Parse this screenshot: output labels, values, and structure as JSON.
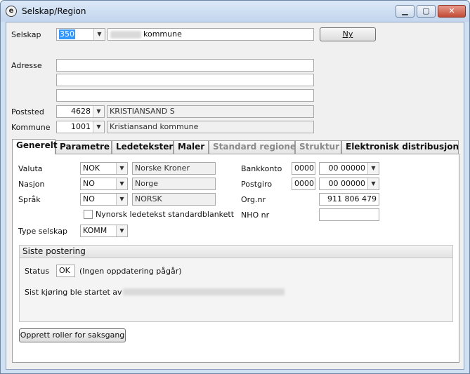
{
  "window": {
    "title": "Selskap/Region",
    "minimize": "▁",
    "maximize": "▢",
    "close": "✕"
  },
  "form": {
    "selskap_label": "Selskap",
    "selskap_value": "350",
    "selskap_name": "kommune",
    "ny_button": "Ny",
    "adresse_label": "Adresse",
    "adresse_lines": [
      "",
      "",
      ""
    ],
    "poststed_label": "Poststed",
    "poststed_code": "4628",
    "poststed_name": "KRISTIANSAND S",
    "kommune_label": "Kommune",
    "kommune_code": "1001",
    "kommune_name": "Kristiansand kommune"
  },
  "tabs": [
    {
      "label": "Generelt",
      "state": "active"
    },
    {
      "label": "Parametre",
      "state": "normal"
    },
    {
      "label": "Ledetekster",
      "state": "normal"
    },
    {
      "label": "Maler",
      "state": "normal"
    },
    {
      "label": "Standard regioner",
      "state": "disabled"
    },
    {
      "label": "Struktur",
      "state": "disabled"
    },
    {
      "label": "Elektronisk distribusjon",
      "state": "normal"
    }
  ],
  "generelt": {
    "valuta_label": "Valuta",
    "valuta_code": "NOK",
    "valuta_name": "Norske Kroner",
    "nasjon_label": "Nasjon",
    "nasjon_code": "NO",
    "nasjon_name": "Norge",
    "sprak_label": "Språk",
    "sprak_code": "NO",
    "sprak_name": "NORSK",
    "nynorsk_label": "Nynorsk ledetekst standardblankett",
    "type_label": "Type selskap",
    "type_value": "KOMM",
    "bankkonto_label": "Bankkonto",
    "bankkonto_prefix": "0000",
    "bankkonto_value": "00 00000",
    "postgiro_label": "Postgiro",
    "postgiro_prefix": "0000",
    "postgiro_value": "00 00000",
    "orgnr_label": "Org.nr",
    "orgnr_value": "911 806 479",
    "nho_label": "NHO nr",
    "nho_value": ""
  },
  "siste_postering": {
    "title": "Siste postering",
    "status_label": "Status",
    "status_value": "OK",
    "status_text": "(Ingen oppdatering pågår)",
    "sist_text": "Sist kjøring ble startet av"
  },
  "opprett_button": "Opprett roller for saksgang"
}
